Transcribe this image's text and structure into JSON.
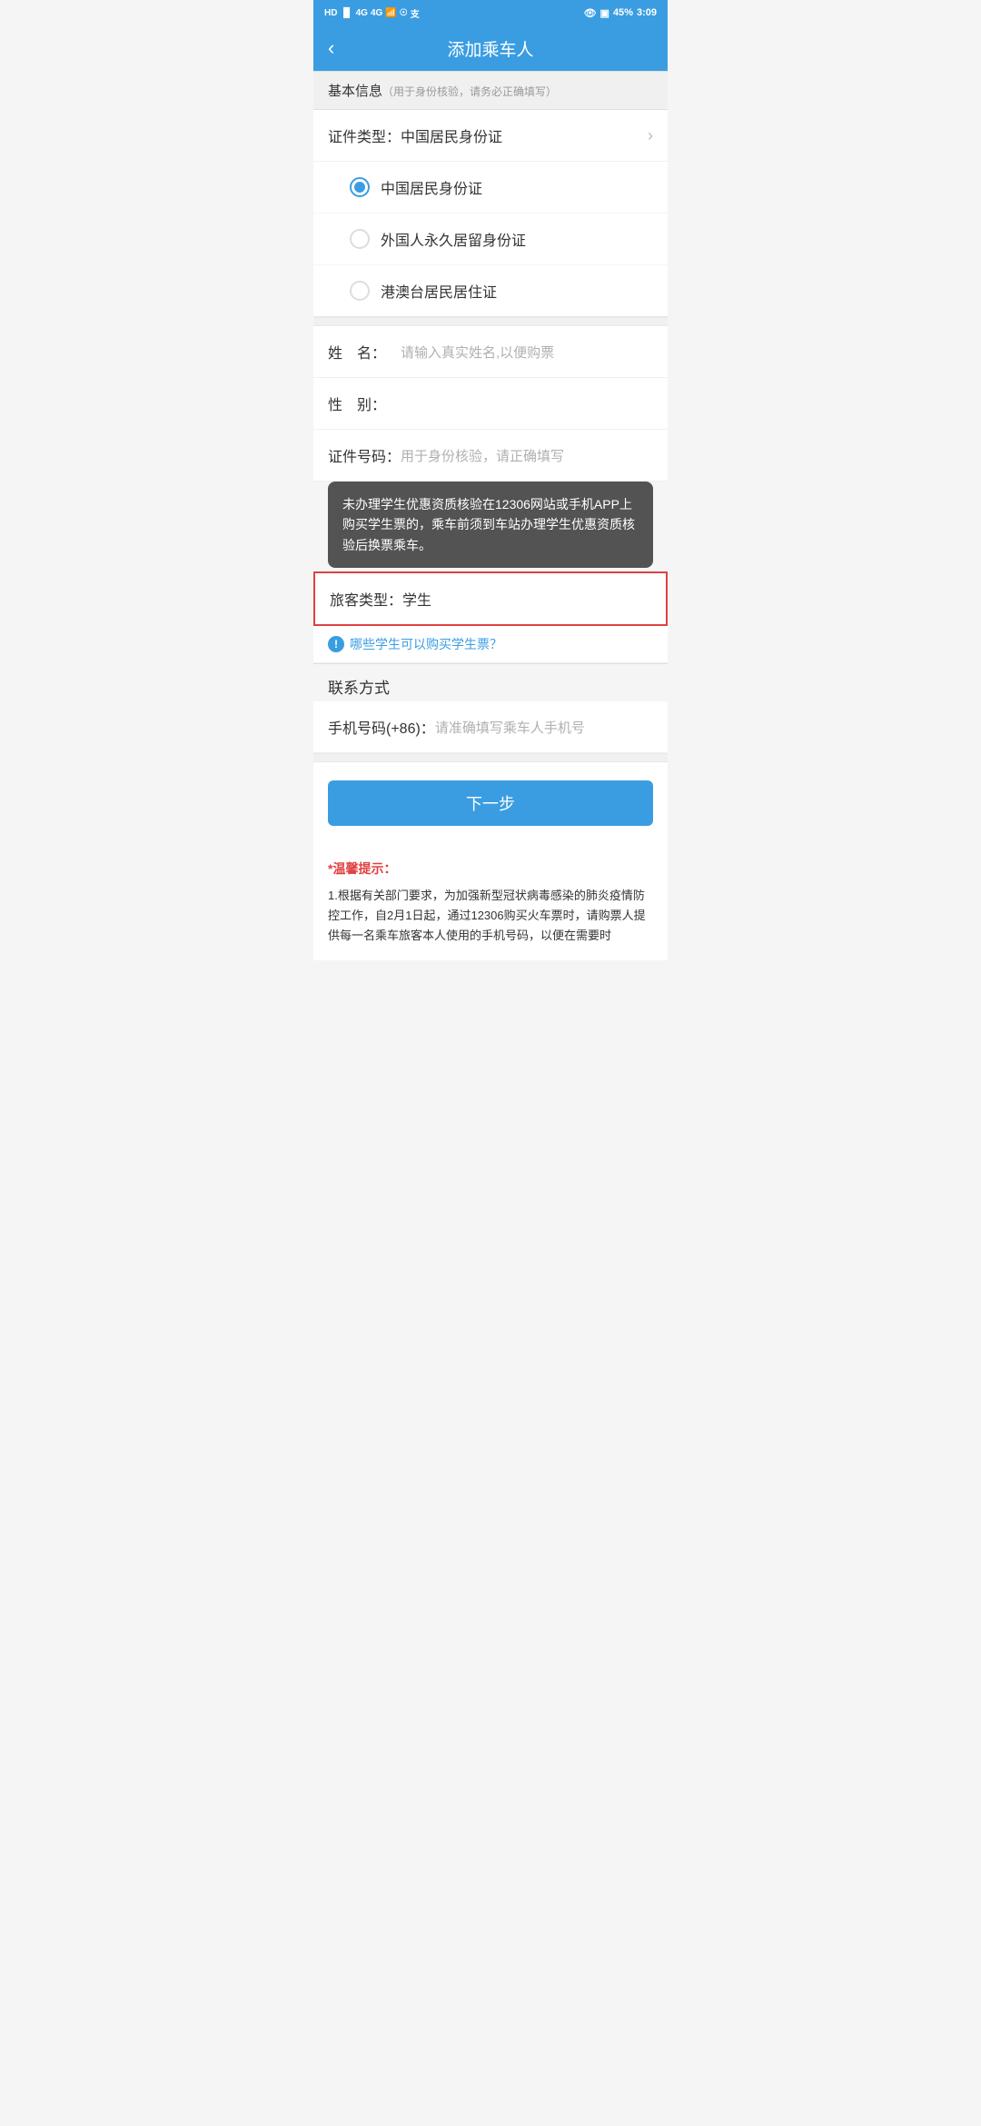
{
  "statusBar": {
    "leftItems": "HD 4G 4G",
    "time": "3:09",
    "battery": "45"
  },
  "header": {
    "back": "‹",
    "title": "添加乘车人"
  },
  "basicInfo": {
    "sectionTitle": "基本信息",
    "sectionNote": "（用于身份核验，请务必正确填写）"
  },
  "certType": {
    "label": "证件类型：",
    "value": "中国居民身份证"
  },
  "radioOptions": [
    {
      "id": "id-card",
      "label": "中国居民身份证",
      "checked": true
    },
    {
      "id": "foreign-card",
      "label": "外国人永久居留身份证",
      "checked": false
    },
    {
      "id": "hk-card",
      "label": "港澳台居民居住证",
      "checked": false
    }
  ],
  "nameField": {
    "label": "姓　名：",
    "placeholder": "请输入真实姓名,以便购票"
  },
  "genderField": {
    "label": "性　别："
  },
  "certNumberField": {
    "label": "证件号码：",
    "placeholder": "用于身份核验，请正确填写"
  },
  "tooltip": {
    "text": "未办理学生优惠资质核验在12306网站或手机APP上购买学生票的，乘车前须到车站办理学生优惠资质核验后换票乘车。"
  },
  "passengerType": {
    "label": "旅客类型：",
    "value": "学生"
  },
  "infoLink": {
    "icon": "!",
    "text": "哪些学生可以购买学生票？"
  },
  "contact": {
    "sectionTitle": "联系方式"
  },
  "phoneField": {
    "label": "手机号码(+86)：",
    "placeholder": "请准确填写乘车人手机号"
  },
  "nextButton": {
    "label": "下一步"
  },
  "warmTips": {
    "title": "*温馨提示：",
    "text": "1.根据有关部门要求，为加强新型冠状病毒感染的肺炎疫情防控工作，自2月1日起，通过12306购买火车票时，请购票人提供每一名乘车旅客本人使用的手机号码，以便在需要时"
  }
}
